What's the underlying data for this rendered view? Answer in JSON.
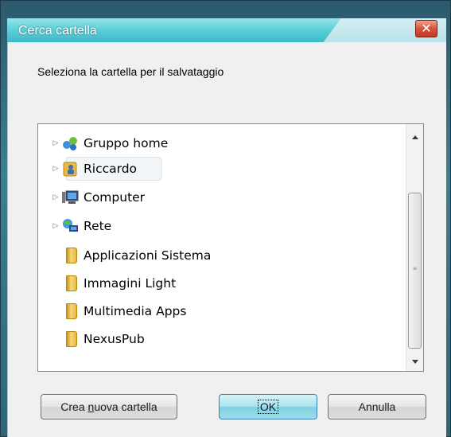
{
  "window": {
    "title": "Cerca cartella",
    "close_glyph": "✕"
  },
  "dialog": {
    "instruction": "Seleziona la cartella per il salvataggio"
  },
  "tree": {
    "items": [
      {
        "label": "Gruppo home",
        "icon": "homegroup-icon",
        "expandable": true
      },
      {
        "label": "Riccardo",
        "icon": "user-folder-icon",
        "expandable": true,
        "selected": true
      },
      {
        "label": "Computer",
        "icon": "computer-icon",
        "expandable": true
      },
      {
        "label": "Rete",
        "icon": "network-icon",
        "expandable": true
      },
      {
        "label": "Applicazioni Sistema",
        "icon": "folder-icon",
        "expandable": false
      },
      {
        "label": "Immagini Light",
        "icon": "folder-icon",
        "expandable": false
      },
      {
        "label": "Multimedia Apps",
        "icon": "folder-icon",
        "expandable": false
      },
      {
        "label": "NexusPub",
        "icon": "folder-icon",
        "expandable": false
      }
    ]
  },
  "buttons": {
    "new_folder_prefix": "Crea ",
    "new_folder_access_key": "n",
    "new_folder_rest": "uova cartella",
    "ok": "OK",
    "cancel": "Annulla"
  },
  "colors": {
    "title_gradient": "#5fd0da",
    "default_button": "#a9e3ef",
    "close_button": "#d9513a"
  }
}
